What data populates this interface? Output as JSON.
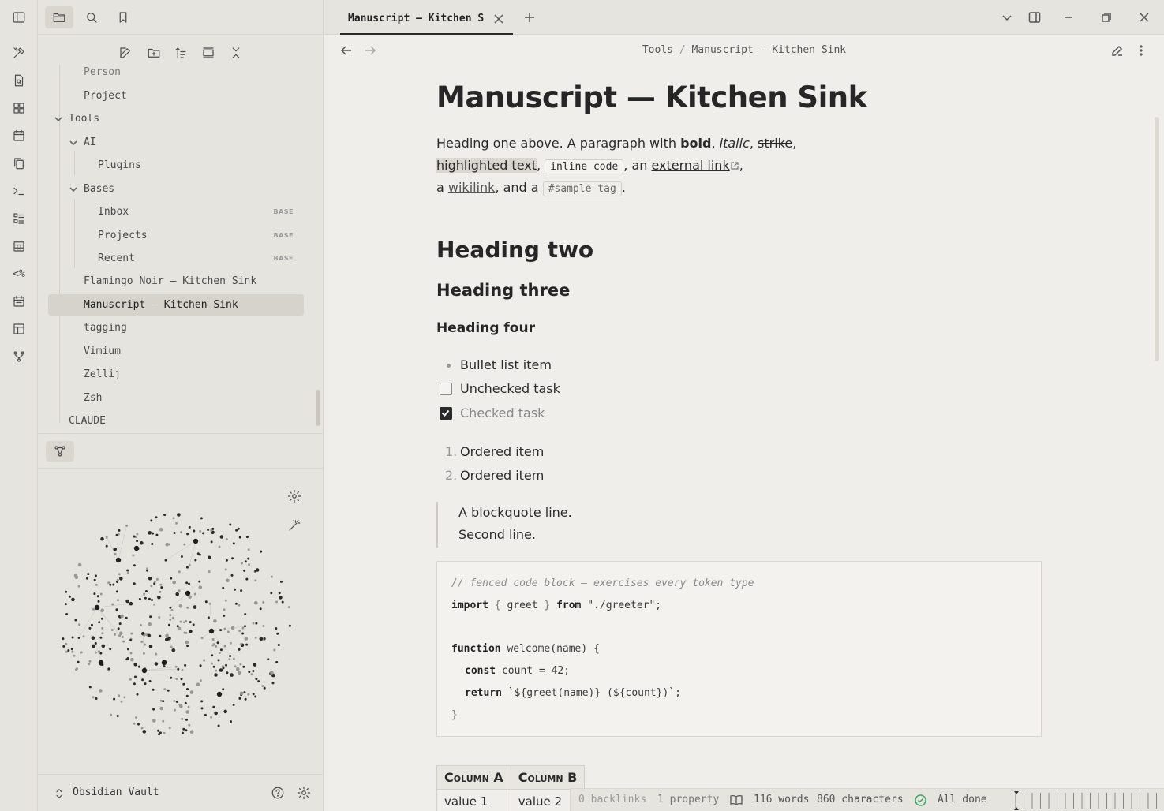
{
  "sidebar": {
    "items": [
      {
        "label": "Person"
      },
      {
        "label": "Project"
      },
      {
        "label": "Tools"
      },
      {
        "label": "AI"
      },
      {
        "label": "Plugins"
      },
      {
        "label": "Bases"
      },
      {
        "label": "Inbox",
        "badge": "BASE"
      },
      {
        "label": "Projects",
        "badge": "BASE"
      },
      {
        "label": "Recent",
        "badge": "BASE"
      },
      {
        "label": "Flamingo Noir — Kitchen Sink"
      },
      {
        "label": "Manuscript — Kitchen Sink"
      },
      {
        "label": "tagging"
      },
      {
        "label": "Vimium"
      },
      {
        "label": "Zellij"
      },
      {
        "label": "Zsh"
      },
      {
        "label": "CLAUDE"
      }
    ],
    "vault_name": "Obsidian Vault"
  },
  "tab": {
    "title": "Manuscript — Kitchen Sink"
  },
  "breadcrumb": {
    "folder": "Tools",
    "separator": "/",
    "file": "Manuscript — Kitchen Sink"
  },
  "doc": {
    "title": "Manuscript — Kitchen Sink",
    "p1": {
      "a": "Heading one above. A paragraph with ",
      "bold": "bold",
      "c1": ", ",
      "italic": "italic",
      "c2": ", ",
      "strike": "strike",
      "c3": ","
    },
    "p2": {
      "highlight": "highlighted text",
      "c1": ", ",
      "code": "inline code",
      "c2": ", an ",
      "link": "external link",
      "c3": ","
    },
    "p3": {
      "a": "a ",
      "wikilink": "wikilink",
      "b": ", and a ",
      "tag": "#sample-tag",
      "c": "."
    },
    "h2": "Heading two",
    "h3": "Heading three",
    "h4": "Heading four",
    "bullet": "Bullet list item",
    "task_unchecked": "Unchecked task",
    "task_checked": "Checked task",
    "ordered": [
      {
        "n": "1.",
        "text": "Ordered item"
      },
      {
        "n": "2.",
        "text": "Ordered item"
      }
    ],
    "quote": [
      "A blockquote line.",
      "Second line."
    ],
    "code": {
      "comment": "// fenced code block — exercises every token type",
      "import_kw": "import",
      "import_open": " { ",
      "import_name": "greet",
      "import_close": " } ",
      "from_kw": "from",
      "import_path": " \"./greeter\";",
      "fn_kw": "function",
      "fn_sig": " welcome(name) {",
      "const_kw": "const",
      "const_rest": " count = 42;",
      "return_kw": "return",
      "return_rest": " `${greet(name)} (${count})`;",
      "close": "}"
    },
    "table": {
      "headers": [
        "Column A",
        "Column B"
      ],
      "rows": [
        [
          "value 1",
          "value 2"
        ]
      ]
    }
  },
  "status": {
    "backlinks": "0 backlinks",
    "properties": "1 property",
    "words": "116 words",
    "chars": "860 characters",
    "sync": "All done"
  }
}
